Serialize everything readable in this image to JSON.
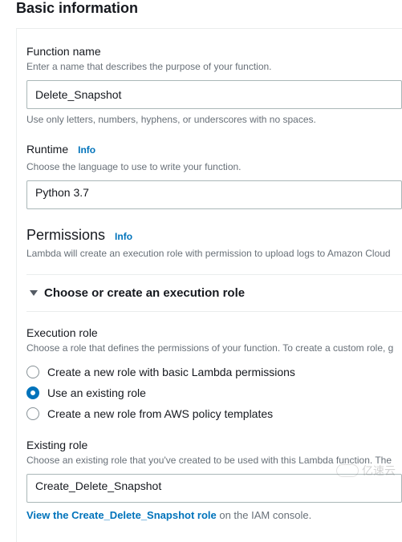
{
  "section_title": "Basic information",
  "function_name": {
    "label": "Function name",
    "desc": "Enter a name that describes the purpose of your function.",
    "value": "Delete_Snapshot",
    "constraint": "Use only letters, numbers, hyphens, or underscores with no spaces."
  },
  "runtime": {
    "label": "Runtime",
    "info": "Info",
    "desc": "Choose the language to use to write your function.",
    "value": "Python 3.7"
  },
  "permissions": {
    "title": "Permissions",
    "info": "Info",
    "desc": "Lambda will create an execution role with permission to upload logs to Amazon Cloud"
  },
  "expander": {
    "label": "Choose or create an execution role"
  },
  "execution_role": {
    "label": "Execution role",
    "desc": "Choose a role that defines the permissions of your function. To create a custom role, g",
    "options": [
      "Create a new role with basic Lambda permissions",
      "Use an existing role",
      "Create a new role from AWS policy templates"
    ],
    "selected_index": 1
  },
  "existing_role": {
    "label": "Existing role",
    "desc": "Choose an existing role that you've created to be used with this Lambda function. The",
    "value": "Create_Delete_Snapshot",
    "view_link": "View the Create_Delete_Snapshot role",
    "view_suffix": " on the IAM console."
  },
  "watermark": "亿速云"
}
